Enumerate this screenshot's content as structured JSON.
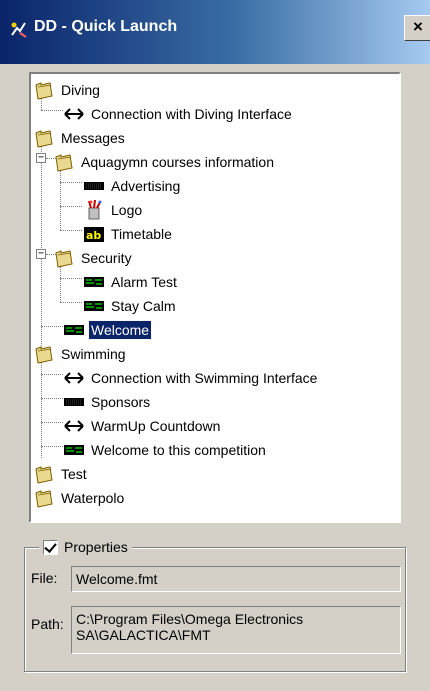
{
  "window": {
    "title": "DD - Quick Launch",
    "close_label": "×"
  },
  "tree": {
    "items": [
      {
        "label": "Diving",
        "icon": "folder-icon",
        "level": 0
      },
      {
        "label": "Connection with Diving Interface",
        "icon": "connection-icon",
        "level": 1
      },
      {
        "label": "Messages",
        "icon": "folder-icon",
        "level": 0
      },
      {
        "label": "Aquagymn courses information",
        "icon": "folder-icon",
        "level": 1,
        "expanded": true
      },
      {
        "label": "Advertising",
        "icon": "display-board-icon",
        "level": 2
      },
      {
        "label": "Logo",
        "icon": "logo-icon",
        "level": 2
      },
      {
        "label": "Timetable",
        "icon": "text-ab-icon",
        "level": 2
      },
      {
        "label": "Security",
        "icon": "folder-icon",
        "level": 1,
        "expanded": true
      },
      {
        "label": "Alarm Test",
        "icon": "message-board-icon",
        "level": 2
      },
      {
        "label": "Stay Calm",
        "icon": "message-board-icon",
        "level": 2
      },
      {
        "label": "Welcome",
        "icon": "message-board-icon",
        "level": 1,
        "selected": true
      },
      {
        "label": "Swimming",
        "icon": "folder-icon",
        "level": 0
      },
      {
        "label": "Connection with Swimming Interface",
        "icon": "connection-icon",
        "level": 1
      },
      {
        "label": "Sponsors",
        "icon": "display-board-icon",
        "level": 1
      },
      {
        "label": "WarmUp Countdown",
        "icon": "connection-icon",
        "level": 1
      },
      {
        "label": "Welcome to this competition",
        "icon": "message-board-icon",
        "level": 1
      },
      {
        "label": "Test",
        "icon": "folder-icon",
        "level": 0
      },
      {
        "label": "Waterpolo",
        "icon": "folder-icon",
        "level": 0
      }
    ]
  },
  "properties": {
    "legend": "Properties",
    "checked": true,
    "file_label": "File:",
    "file_value": "Welcome.fmt",
    "path_label": "Path:",
    "path_value": "C:\\Program Files\\Omega Electronics SA\\GALACTICA\\FMT"
  },
  "colors": {
    "title_gradient_start": "#0a246a",
    "title_gradient_end": "#a6caf0",
    "selection": "#0a246a",
    "folder": "#e8d890",
    "window_bg": "#d4d0c8"
  }
}
